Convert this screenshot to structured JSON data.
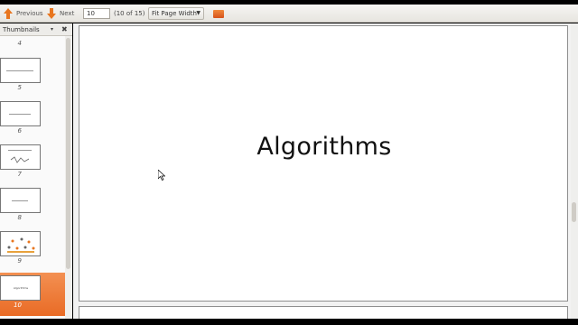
{
  "toolbar": {
    "previous_label": "Previous",
    "next_label": "Next",
    "page_value": "10",
    "page_count": "(10 of 15)",
    "zoom_value": "Fit Page Width"
  },
  "sidebar": {
    "title": "Thumbnails",
    "thumbnails": [
      {
        "page": "4"
      },
      {
        "page": "5"
      },
      {
        "page": "6"
      },
      {
        "page": "7"
      },
      {
        "page": "8"
      },
      {
        "page": "9"
      },
      {
        "page": "10",
        "selected": true
      }
    ]
  },
  "slide": {
    "title": "Algorithms"
  },
  "colors": {
    "accent": "#e96b25",
    "arrow": "#e8761f"
  }
}
